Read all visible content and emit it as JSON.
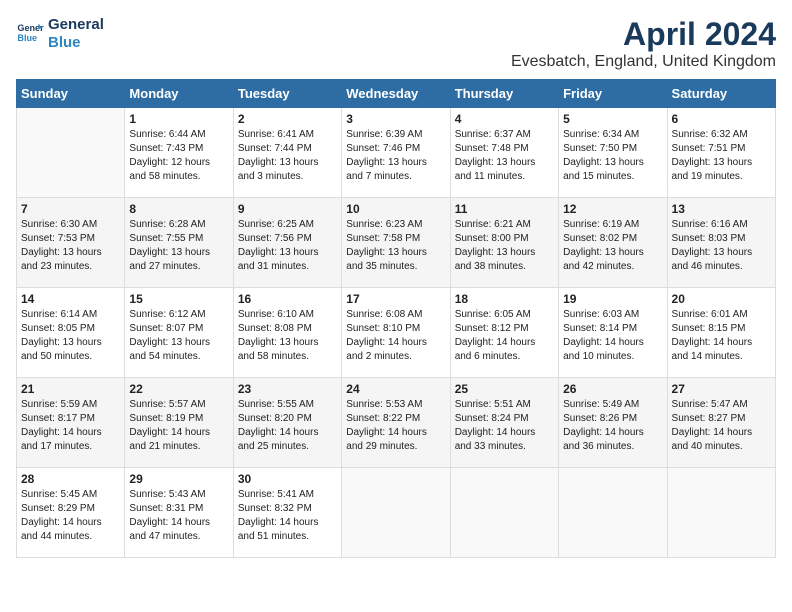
{
  "header": {
    "logo_line1": "General",
    "logo_line2": "Blue",
    "month": "April 2024",
    "location": "Evesbatch, England, United Kingdom"
  },
  "weekdays": [
    "Sunday",
    "Monday",
    "Tuesday",
    "Wednesday",
    "Thursday",
    "Friday",
    "Saturday"
  ],
  "weeks": [
    [
      {
        "day": "",
        "sunrise": "",
        "sunset": "",
        "daylight": ""
      },
      {
        "day": "1",
        "sunrise": "Sunrise: 6:44 AM",
        "sunset": "Sunset: 7:43 PM",
        "daylight": "Daylight: 12 hours and 58 minutes."
      },
      {
        "day": "2",
        "sunrise": "Sunrise: 6:41 AM",
        "sunset": "Sunset: 7:44 PM",
        "daylight": "Daylight: 13 hours and 3 minutes."
      },
      {
        "day": "3",
        "sunrise": "Sunrise: 6:39 AM",
        "sunset": "Sunset: 7:46 PM",
        "daylight": "Daylight: 13 hours and 7 minutes."
      },
      {
        "day": "4",
        "sunrise": "Sunrise: 6:37 AM",
        "sunset": "Sunset: 7:48 PM",
        "daylight": "Daylight: 13 hours and 11 minutes."
      },
      {
        "day": "5",
        "sunrise": "Sunrise: 6:34 AM",
        "sunset": "Sunset: 7:50 PM",
        "daylight": "Daylight: 13 hours and 15 minutes."
      },
      {
        "day": "6",
        "sunrise": "Sunrise: 6:32 AM",
        "sunset": "Sunset: 7:51 PM",
        "daylight": "Daylight: 13 hours and 19 minutes."
      }
    ],
    [
      {
        "day": "7",
        "sunrise": "Sunrise: 6:30 AM",
        "sunset": "Sunset: 7:53 PM",
        "daylight": "Daylight: 13 hours and 23 minutes."
      },
      {
        "day": "8",
        "sunrise": "Sunrise: 6:28 AM",
        "sunset": "Sunset: 7:55 PM",
        "daylight": "Daylight: 13 hours and 27 minutes."
      },
      {
        "day": "9",
        "sunrise": "Sunrise: 6:25 AM",
        "sunset": "Sunset: 7:56 PM",
        "daylight": "Daylight: 13 hours and 31 minutes."
      },
      {
        "day": "10",
        "sunrise": "Sunrise: 6:23 AM",
        "sunset": "Sunset: 7:58 PM",
        "daylight": "Daylight: 13 hours and 35 minutes."
      },
      {
        "day": "11",
        "sunrise": "Sunrise: 6:21 AM",
        "sunset": "Sunset: 8:00 PM",
        "daylight": "Daylight: 13 hours and 38 minutes."
      },
      {
        "day": "12",
        "sunrise": "Sunrise: 6:19 AM",
        "sunset": "Sunset: 8:02 PM",
        "daylight": "Daylight: 13 hours and 42 minutes."
      },
      {
        "day": "13",
        "sunrise": "Sunrise: 6:16 AM",
        "sunset": "Sunset: 8:03 PM",
        "daylight": "Daylight: 13 hours and 46 minutes."
      }
    ],
    [
      {
        "day": "14",
        "sunrise": "Sunrise: 6:14 AM",
        "sunset": "Sunset: 8:05 PM",
        "daylight": "Daylight: 13 hours and 50 minutes."
      },
      {
        "day": "15",
        "sunrise": "Sunrise: 6:12 AM",
        "sunset": "Sunset: 8:07 PM",
        "daylight": "Daylight: 13 hours and 54 minutes."
      },
      {
        "day": "16",
        "sunrise": "Sunrise: 6:10 AM",
        "sunset": "Sunset: 8:08 PM",
        "daylight": "Daylight: 13 hours and 58 minutes."
      },
      {
        "day": "17",
        "sunrise": "Sunrise: 6:08 AM",
        "sunset": "Sunset: 8:10 PM",
        "daylight": "Daylight: 14 hours and 2 minutes."
      },
      {
        "day": "18",
        "sunrise": "Sunrise: 6:05 AM",
        "sunset": "Sunset: 8:12 PM",
        "daylight": "Daylight: 14 hours and 6 minutes."
      },
      {
        "day": "19",
        "sunrise": "Sunrise: 6:03 AM",
        "sunset": "Sunset: 8:14 PM",
        "daylight": "Daylight: 14 hours and 10 minutes."
      },
      {
        "day": "20",
        "sunrise": "Sunrise: 6:01 AM",
        "sunset": "Sunset: 8:15 PM",
        "daylight": "Daylight: 14 hours and 14 minutes."
      }
    ],
    [
      {
        "day": "21",
        "sunrise": "Sunrise: 5:59 AM",
        "sunset": "Sunset: 8:17 PM",
        "daylight": "Daylight: 14 hours and 17 minutes."
      },
      {
        "day": "22",
        "sunrise": "Sunrise: 5:57 AM",
        "sunset": "Sunset: 8:19 PM",
        "daylight": "Daylight: 14 hours and 21 minutes."
      },
      {
        "day": "23",
        "sunrise": "Sunrise: 5:55 AM",
        "sunset": "Sunset: 8:20 PM",
        "daylight": "Daylight: 14 hours and 25 minutes."
      },
      {
        "day": "24",
        "sunrise": "Sunrise: 5:53 AM",
        "sunset": "Sunset: 8:22 PM",
        "daylight": "Daylight: 14 hours and 29 minutes."
      },
      {
        "day": "25",
        "sunrise": "Sunrise: 5:51 AM",
        "sunset": "Sunset: 8:24 PM",
        "daylight": "Daylight: 14 hours and 33 minutes."
      },
      {
        "day": "26",
        "sunrise": "Sunrise: 5:49 AM",
        "sunset": "Sunset: 8:26 PM",
        "daylight": "Daylight: 14 hours and 36 minutes."
      },
      {
        "day": "27",
        "sunrise": "Sunrise: 5:47 AM",
        "sunset": "Sunset: 8:27 PM",
        "daylight": "Daylight: 14 hours and 40 minutes."
      }
    ],
    [
      {
        "day": "28",
        "sunrise": "Sunrise: 5:45 AM",
        "sunset": "Sunset: 8:29 PM",
        "daylight": "Daylight: 14 hours and 44 minutes."
      },
      {
        "day": "29",
        "sunrise": "Sunrise: 5:43 AM",
        "sunset": "Sunset: 8:31 PM",
        "daylight": "Daylight: 14 hours and 47 minutes."
      },
      {
        "day": "30",
        "sunrise": "Sunrise: 5:41 AM",
        "sunset": "Sunset: 8:32 PM",
        "daylight": "Daylight: 14 hours and 51 minutes."
      },
      {
        "day": "",
        "sunrise": "",
        "sunset": "",
        "daylight": ""
      },
      {
        "day": "",
        "sunrise": "",
        "sunset": "",
        "daylight": ""
      },
      {
        "day": "",
        "sunrise": "",
        "sunset": "",
        "daylight": ""
      },
      {
        "day": "",
        "sunrise": "",
        "sunset": "",
        "daylight": ""
      }
    ]
  ]
}
